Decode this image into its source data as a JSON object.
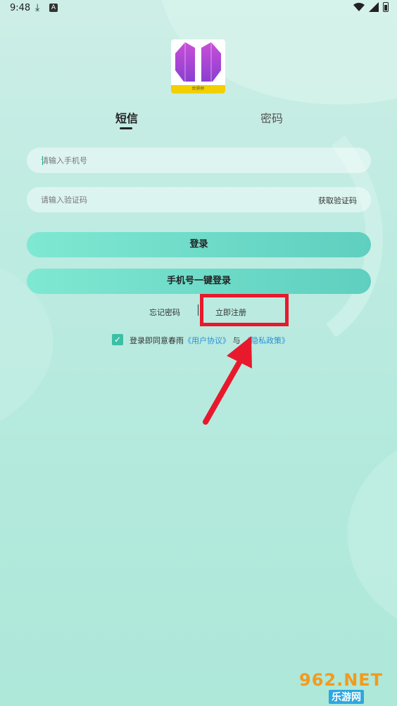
{
  "status": {
    "time": "9:48"
  },
  "logo": {
    "caption": "世界杯"
  },
  "tabs": [
    {
      "label": "短信"
    },
    {
      "label": "密码"
    }
  ],
  "form": {
    "phone_placeholder": "请输入手机号",
    "code_placeholder": "请输入验证码",
    "get_code_label": "获取验证码"
  },
  "buttons": {
    "login": "登录",
    "one_key_login": "手机号一键登录"
  },
  "links": {
    "forget_password": "忘记密码",
    "register": "立即注册"
  },
  "agreement": {
    "prefix": "登录即同意春雨",
    "user_agreement": "《用户协议》",
    "joiner": "与",
    "privacy_policy": "《隐私政策》",
    "checked": true
  },
  "watermark": {
    "top": "962.NET",
    "bottom": "乐游网"
  },
  "colors": {
    "accent": "#5fcfbf",
    "highlight": "#e8192c",
    "link": "#2a8fd6"
  }
}
